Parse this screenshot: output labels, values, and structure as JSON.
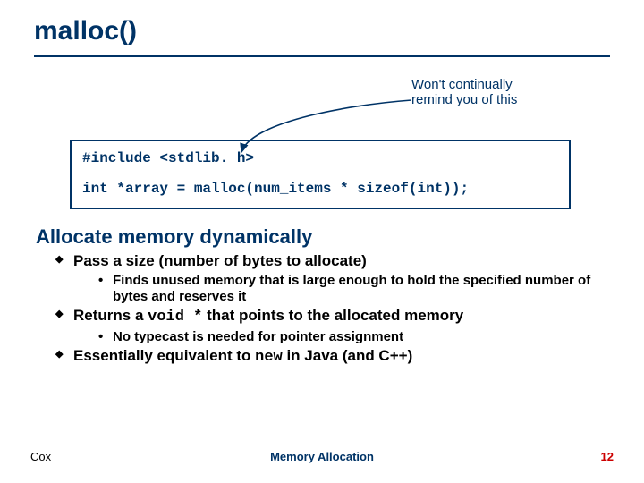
{
  "title": "malloc()",
  "callout": {
    "line1": "Won't continually",
    "line2": "remind you of this"
  },
  "code": {
    "line1": "#include <stdlib. h>",
    "line2": "int *array = malloc(num_items * sizeof(int));"
  },
  "heading": "Allocate memory dynamically",
  "bullets": {
    "b1": "Pass a size (number of bytes to allocate)",
    "b1_sub": "Finds unused memory that is large enough to hold the specified number of bytes and reserves it",
    "b2_pre": "Returns a ",
    "b2_code": "void *",
    "b2_post": " that points to the allocated memory",
    "b2_sub": "No typecast is needed for pointer assignment",
    "b3_pre": "Essentially equivalent to ",
    "b3_code": "new",
    "b3_post": " in Java (and C++)"
  },
  "footer": {
    "left": "Cox",
    "center": "Memory Allocation",
    "right": "12"
  }
}
